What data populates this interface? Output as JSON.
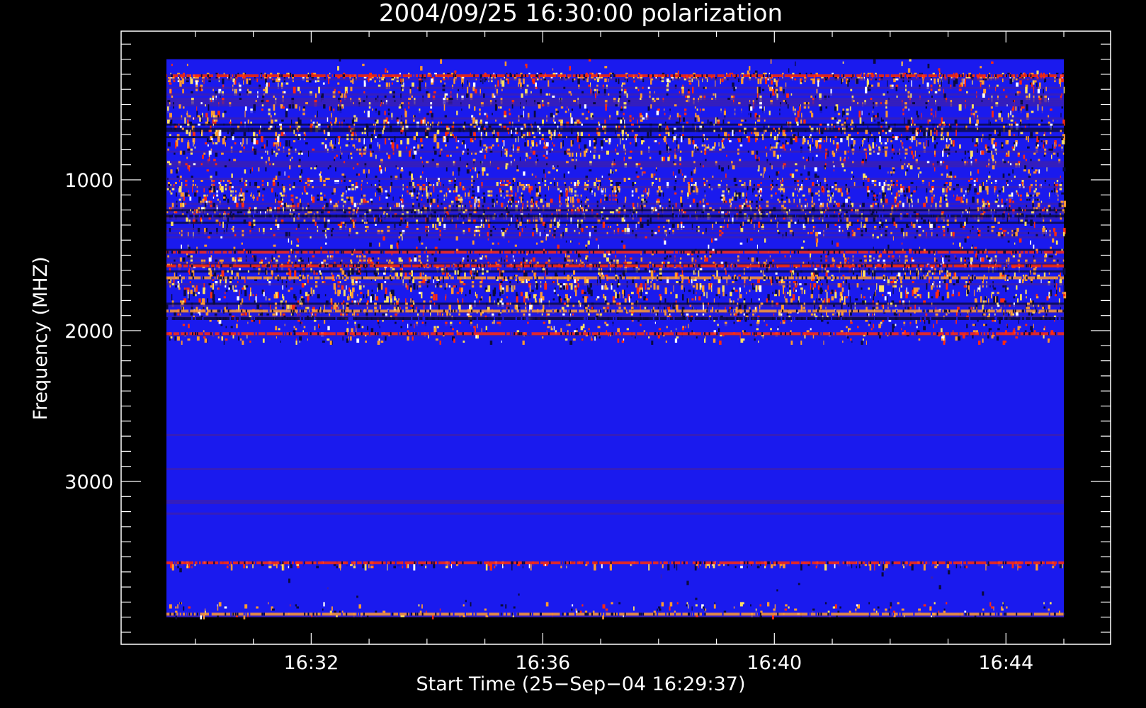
{
  "chart_data": {
    "type": "heatmap",
    "title": "2004/09/25 16:30:00 polarization",
    "xlabel": "Start Time (25−Sep−04 16:29:37)",
    "ylabel": "Frequency (MHZ)",
    "x_ticks": [
      "16:32",
      "16:36",
      "16:40",
      "16:44"
    ],
    "x_tick_minutes": [
      32,
      36,
      40,
      44
    ],
    "x_range_minutes": [
      29.5,
      45.0
    ],
    "y_ticks": [
      1000,
      2000,
      3000
    ],
    "y_range": [
      100,
      4000
    ],
    "data_y_range": [
      200,
      3900
    ],
    "colors": {
      "background": "#000000",
      "base": "#1a1aee",
      "mid": "#3c1fb0",
      "dark": "#0a0a40",
      "red": "#ff2a10",
      "orange": "#ff9a30",
      "yellow": "#ffe060",
      "white": "#ffffff",
      "axis": "#ffffff"
    },
    "bands": [
      {
        "from": 200,
        "to": 290,
        "intensity": 0.2
      },
      {
        "from": 290,
        "to": 340,
        "intensity": 0.95
      },
      {
        "from": 340,
        "to": 600,
        "intensity": 0.55
      },
      {
        "from": 600,
        "to": 820,
        "intensity": 0.7
      },
      {
        "from": 820,
        "to": 1000,
        "intensity": 0.5
      },
      {
        "from": 1000,
        "to": 1250,
        "intensity": 0.75
      },
      {
        "from": 1250,
        "to": 1360,
        "intensity": 0.6
      },
      {
        "from": 1360,
        "to": 1500,
        "intensity": 0.35
      },
      {
        "from": 1500,
        "to": 1900,
        "intensity": 0.7
      },
      {
        "from": 1900,
        "to": 2080,
        "intensity": 0.5
      },
      {
        "from": 2080,
        "to": 3530,
        "intensity": 0.04
      },
      {
        "from": 3530,
        "to": 3560,
        "intensity": 0.9
      },
      {
        "from": 3560,
        "to": 3800,
        "intensity": 0.08
      },
      {
        "from": 3800,
        "to": 3900,
        "intensity": 0.45
      }
    ],
    "strong_lines": [
      {
        "freq": 310,
        "color": "red"
      },
      {
        "freq": 1240,
        "color": "dark"
      },
      {
        "freq": 1480,
        "color": "red"
      },
      {
        "freq": 1570,
        "color": "red"
      },
      {
        "freq": 1650,
        "color": "orange"
      },
      {
        "freq": 1870,
        "color": "orange"
      },
      {
        "freq": 1920,
        "color": "dark"
      },
      {
        "freq": 2020,
        "color": "red"
      },
      {
        "freq": 3540,
        "color": "red"
      },
      {
        "freq": 3880,
        "color": "orange"
      }
    ]
  }
}
